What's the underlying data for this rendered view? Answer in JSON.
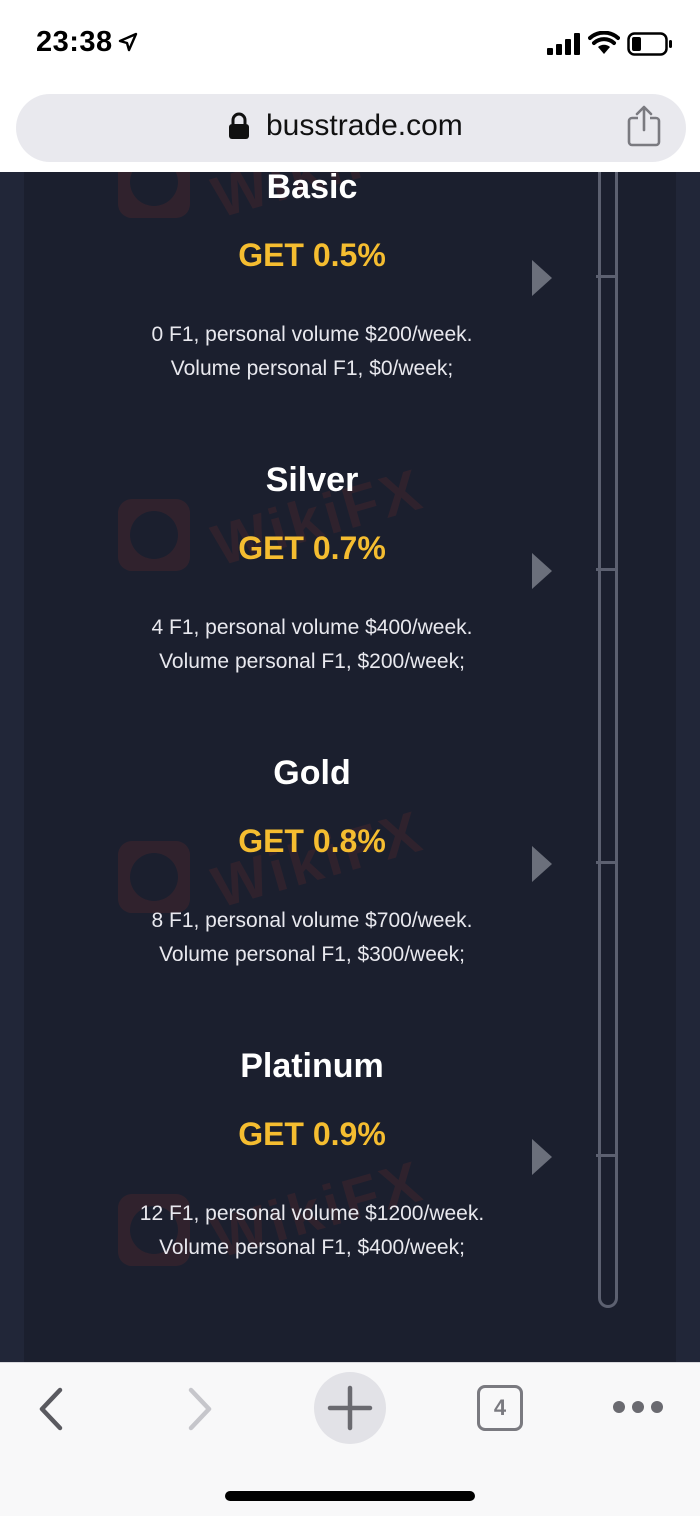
{
  "status_bar": {
    "time": "23:38",
    "location_icon": "location-arrow-icon",
    "signal_icon": "cellular-signal-icon",
    "wifi_icon": "wifi-icon",
    "battery_icon": "battery-icon"
  },
  "browser": {
    "url": "busstrade.com",
    "tab_count": "4"
  },
  "tiers": [
    {
      "name": "Basic",
      "get": "GET 0.5%",
      "line1": "0 F1, personal volume $200/week.",
      "line2": "Volume personal F1, $0/week;"
    },
    {
      "name": "Silver",
      "get": "GET 0.7%",
      "line1": "4 F1, personal volume $400/week.",
      "line2": "Volume personal F1, $200/week;"
    },
    {
      "name": "Gold",
      "get": "GET 0.8%",
      "line1": "8 F1, personal volume $700/week.",
      "line2": "Volume personal F1, $300/week;"
    },
    {
      "name": "Platinum",
      "get": "GET 0.9%",
      "line1": "12 F1, personal volume $1200/week.",
      "line2": "Volume personal F1, $400/week;"
    }
  ],
  "colors": {
    "page_bg": "#212638",
    "panel_bg": "#1b1f2e",
    "accent_gold": "#f5bd30"
  },
  "watermark": "WikiFX"
}
